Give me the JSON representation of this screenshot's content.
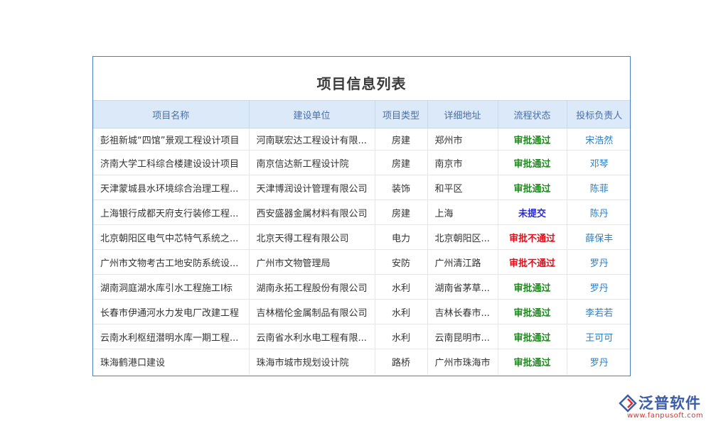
{
  "title": "项目信息列表",
  "columns": [
    "项目名称",
    "建设单位",
    "项目类型",
    "详细地址",
    "流程状态",
    "投标负责人"
  ],
  "rows": [
    {
      "name": "彭祖新城“四馆”景观工程设计项目",
      "unit": "河南联宏达工程设计有限...",
      "type": "房建",
      "address": "郑州市",
      "status": "审批通过",
      "person": "宋浩然"
    },
    {
      "name": "济南大学工科综合楼建设设计项目",
      "unit": "南京信达新工程设计院",
      "type": "房建",
      "address": "南京市",
      "status": "审批通过",
      "person": "邓琴"
    },
    {
      "name": "天津蒙城县水环境综合治理工程...",
      "unit": "天津博润设计管理有限公司",
      "type": "装饰",
      "address": "和平区",
      "status": "审批通过",
      "person": "陈菲"
    },
    {
      "name": "上海银行成都天府支行装修工程...",
      "unit": "西安盛器金属材料有限公司",
      "type": "房建",
      "address": "上海",
      "status": "未提交",
      "person": "陈丹"
    },
    {
      "name": "北京朝阳区电气中芯特气系统之...",
      "unit": "北京天得工程有限公司",
      "type": "电力",
      "address": "北京朝阳区...",
      "status": "审批不通过",
      "person": "薛保丰"
    },
    {
      "name": "广州市文物考古工地安防系统设...",
      "unit": "广州市文物管理局",
      "type": "安防",
      "address": "广州清江路",
      "status": "审批不通过",
      "person": "罗丹"
    },
    {
      "name": "湖南洞庭湖水库引水工程施工I标",
      "unit": "湖南永拓工程股份有限公司",
      "type": "水利",
      "address": "湖南省茅草...",
      "status": "审批通过",
      "person": "罗丹"
    },
    {
      "name": "长春市伊通河水力发电厂改建工程",
      "unit": "吉林楷伦金属制品有限公司",
      "type": "水利",
      "address": "吉林长春市...",
      "status": "审批通过",
      "person": "李若若"
    },
    {
      "name": "云南水利枢纽潜明水库一期工程...",
      "unit": "云南省水利水电工程有限...",
      "type": "水利",
      "address": "云南昆明市...",
      "status": "审批通过",
      "person": "王可可"
    },
    {
      "name": "珠海鹤港口建设",
      "unit": "珠海市城市规划设计院",
      "type": "路桥",
      "address": "广州市珠海市",
      "status": "审批通过",
      "person": "罗丹"
    }
  ],
  "status_colors": {
    "审批通过": "#1e8a1e",
    "审批不通过": "#e0101a",
    "未提交": "#2a2ad0"
  },
  "logo": {
    "name": "泛普软件",
    "url": "www.fanpusoft.com"
  }
}
